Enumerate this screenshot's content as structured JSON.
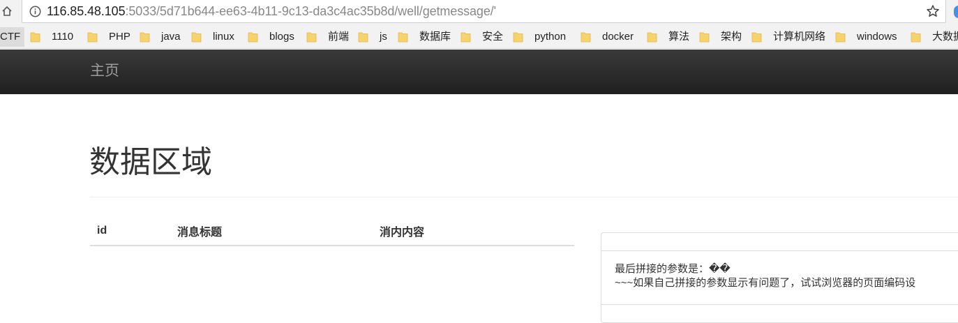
{
  "browser": {
    "url_host": "116.85.48.105",
    "url_rest": ":5033/5d71b644-ee63-4b11-9c13-da3c4ac35b8d/well/getmessage/'",
    "bookmarks": [
      "CTF",
      "1110",
      "PHP",
      "java",
      "linux",
      "blogs",
      "前端",
      "js",
      "数据库",
      "安全",
      "python",
      "docker",
      "算法",
      "架构",
      "计算机网络",
      "windows",
      "大数据"
    ]
  },
  "navbar": {
    "brand": "主页"
  },
  "page": {
    "title": "数据区域",
    "table_headers": [
      "id",
      "消息标题",
      "消内内容"
    ],
    "panel_line1": "最后拼接的参数是：��",
    "panel_line2": "~~~如果自己拼接的参数显示有问题了，试试浏览器的页面编码设"
  },
  "colors": {
    "navbar_top": "#3a3a3a",
    "navbar_bottom": "#1f1f1f",
    "folder": "#f7d36e",
    "brand_text": "#9d9d9d"
  }
}
